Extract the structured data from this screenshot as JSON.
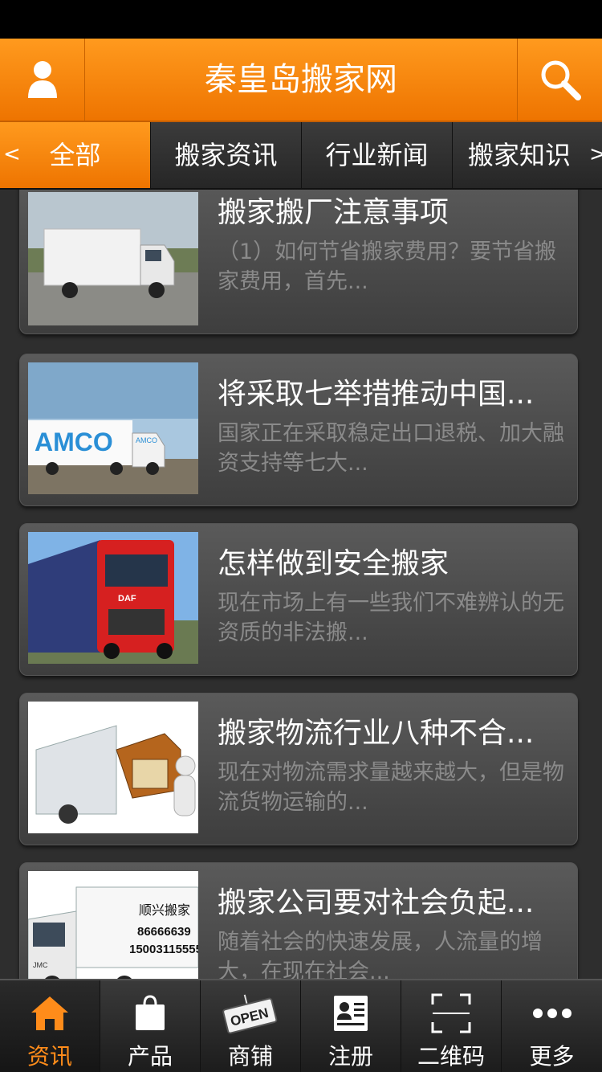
{
  "app": {
    "title": "秦皇岛搬家网"
  },
  "tabs": {
    "left_arrow": "<",
    "right_arrow": ">",
    "items": [
      {
        "label": "全部",
        "active": true
      },
      {
        "label": "搬家资讯",
        "active": false
      },
      {
        "label": "行业新闻",
        "active": false
      },
      {
        "label": "搬家知识",
        "active": false
      }
    ]
  },
  "articles": [
    {
      "title": "搬家搬厂注意事项",
      "desc": "（1）如何节省搬家费用？要节省搬家费用，首先..."
    },
    {
      "title": "将采取七举措推动中国...",
      "desc": "国家正在采取稳定出口退税、加大融资支持等七大..."
    },
    {
      "title": "怎样做到安全搬家",
      "desc": "现在市场上有一些我们不难辨认的无资质的非法搬..."
    },
    {
      "title": "搬家物流行业八种不合...",
      "desc": "现在对物流需求量越来越大，但是物流货物运输的..."
    },
    {
      "title": "搬家公司要对社会负起...",
      "desc": "随着社会的快速发展，人流量的增大，在现在社会..."
    }
  ],
  "images": {
    "truck_logo_text": "AMCO",
    "truck_logo_small": "AMCO",
    "truck_brand": "DAF",
    "van_company": "顺兴搬家",
    "van_phone1": "86666639",
    "van_phone2": "15003115555",
    "van_cab_brand": "JMC",
    "open_sign": "OPEN"
  },
  "bottom_nav": [
    {
      "label": "资讯",
      "icon": "home-icon",
      "active": true
    },
    {
      "label": "产品",
      "icon": "shopping-bag-icon",
      "active": false
    },
    {
      "label": "商铺",
      "icon": "open-sign-icon",
      "active": false
    },
    {
      "label": "注册",
      "icon": "register-card-icon",
      "active": false
    },
    {
      "label": "二维码",
      "icon": "qr-scan-icon",
      "active": false
    },
    {
      "label": "更多",
      "icon": "more-dots-icon",
      "active": false
    }
  ],
  "colors": {
    "accent": "#ff8c1a",
    "header": "#f5820a",
    "background": "#2e2e2e"
  }
}
